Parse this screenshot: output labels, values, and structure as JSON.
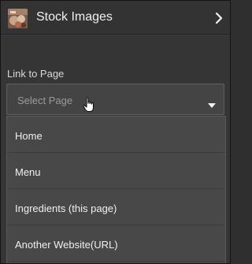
{
  "header": {
    "title": "Stock Images",
    "thumbnail_icon": "food-photo-thumbnail",
    "chevron_icon": "chevron-right-icon"
  },
  "link_field": {
    "label": "Link to Page",
    "placeholder": "Select Page",
    "caret_icon": "caret-down-icon"
  },
  "dropdown": {
    "options": [
      {
        "label": "Home"
      },
      {
        "label": "Menu"
      },
      {
        "label": "Ingredients (this page)"
      },
      {
        "label": "Another Website(URL)"
      }
    ]
  },
  "colors": {
    "panel_background": "#353535",
    "dropdown_background": "#484848",
    "text": "#f0f0f0",
    "placeholder_text": "#9a9a9a"
  }
}
